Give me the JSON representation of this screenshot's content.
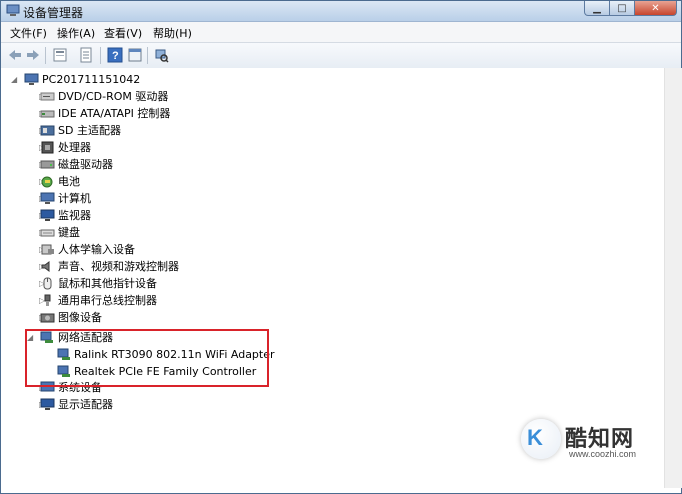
{
  "window": {
    "title": "设备管理器"
  },
  "menu": [
    "文件(F)",
    "操作(A)",
    "查看(V)",
    "帮助(H)"
  ],
  "tree": {
    "root": "PC201711151042",
    "categories": [
      "DVD/CD-ROM 驱动器",
      "IDE ATA/ATAPI 控制器",
      "SD 主适配器",
      "处理器",
      "磁盘驱动器",
      "电池",
      "计算机",
      "监视器",
      "键盘",
      "人体学输入设备",
      "声音、视频和游戏控制器",
      "鼠标和其他指针设备",
      "通用串行总线控制器",
      "图像设备",
      "网络适配器",
      "系统设备",
      "显示适配器"
    ],
    "network_children": [
      "Ralink RT3090 802.11n WiFi Adapter",
      "Realtek PCIe FE Family Controller"
    ]
  },
  "watermark": {
    "badge": "K",
    "name": "酷知网",
    "url": "www.coozhi.com"
  },
  "colors": {
    "highlight": "#d9232a",
    "titlebar": "#c9dcef"
  }
}
